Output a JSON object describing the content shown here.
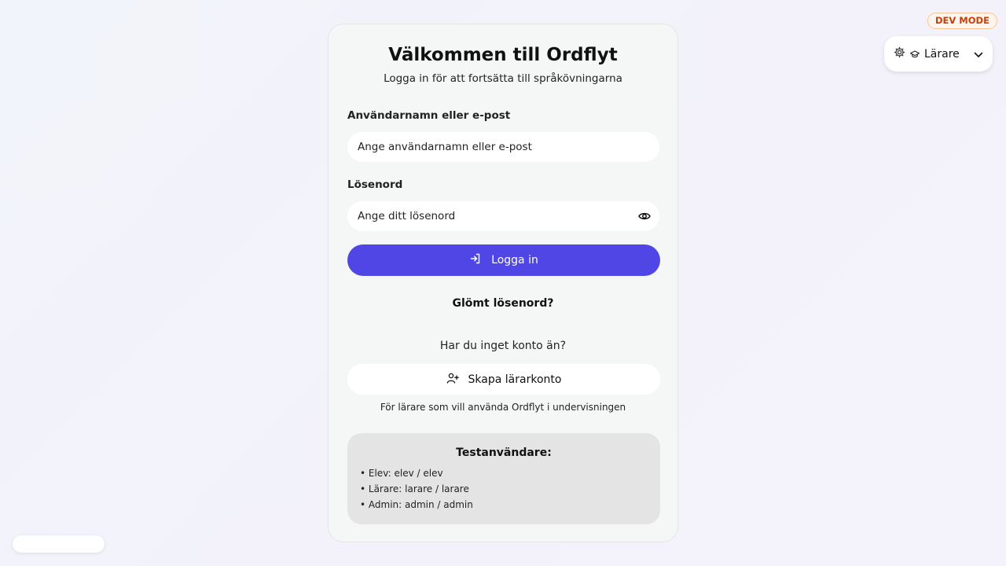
{
  "login": {
    "title": "Välkommen till Ordflyt",
    "subtitle": "Logga in för att fortsätta till språkövningarna",
    "username_label": "Användarnamn eller e-post",
    "username_placeholder": "Ange användarnamn eller e-post",
    "password_label": "Lösenord",
    "password_placeholder": "Ange ditt lösenord",
    "login_button": "Logga in",
    "forgot_link": "Glömt lösenord?",
    "no_account_text": "Har du inget konto än?",
    "create_button": "Skapa lärarkonto",
    "teacher_note": "För lärare som vill använda Ordflyt i undervisningen"
  },
  "test_users": {
    "title": "Testanvändare:",
    "items": [
      "• Elev: elev / elev",
      "• Lärare: larare / larare",
      "• Admin: admin / admin"
    ]
  },
  "dev": {
    "badge": "DEV MODE",
    "role_label": "Lärare"
  },
  "colors": {
    "primary": "#4f46e5",
    "badge_text": "#c2410c"
  },
  "icons": [
    "eye-icon",
    "login-icon",
    "user-plus-icon",
    "gear-icon",
    "graduation-cap-icon",
    "chevron-down-icon"
  ]
}
